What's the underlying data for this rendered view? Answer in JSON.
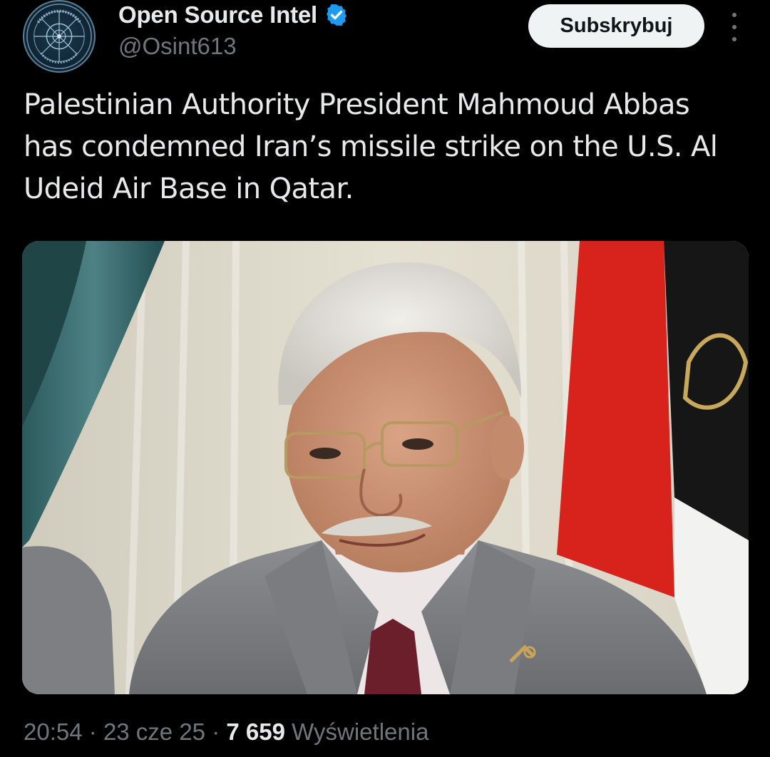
{
  "author": {
    "name": "Open Source Intel",
    "handle": "@Osint613",
    "verified": true,
    "avatar_text": "OPEN SOURCE INTEL"
  },
  "header": {
    "subscribe_label": "Subskrybuj",
    "more_icon": "more-vertical-icon"
  },
  "post": {
    "text": "Palestinian Authority President Mahmoud Abbas has condemned Iran’s missile strike on the U.S. Al Udeid Air Base in Qatar."
  },
  "meta": {
    "time": "20:54",
    "separator": "·",
    "date": "23 cze 25",
    "views_count": "7 659",
    "views_label": "Wyświetlenia"
  },
  "colors": {
    "background": "#000000",
    "text_primary": "#e7e9ea",
    "text_secondary": "#71767b",
    "verified_blue": "#1d9bf0",
    "button_bg": "#eff3f4"
  }
}
